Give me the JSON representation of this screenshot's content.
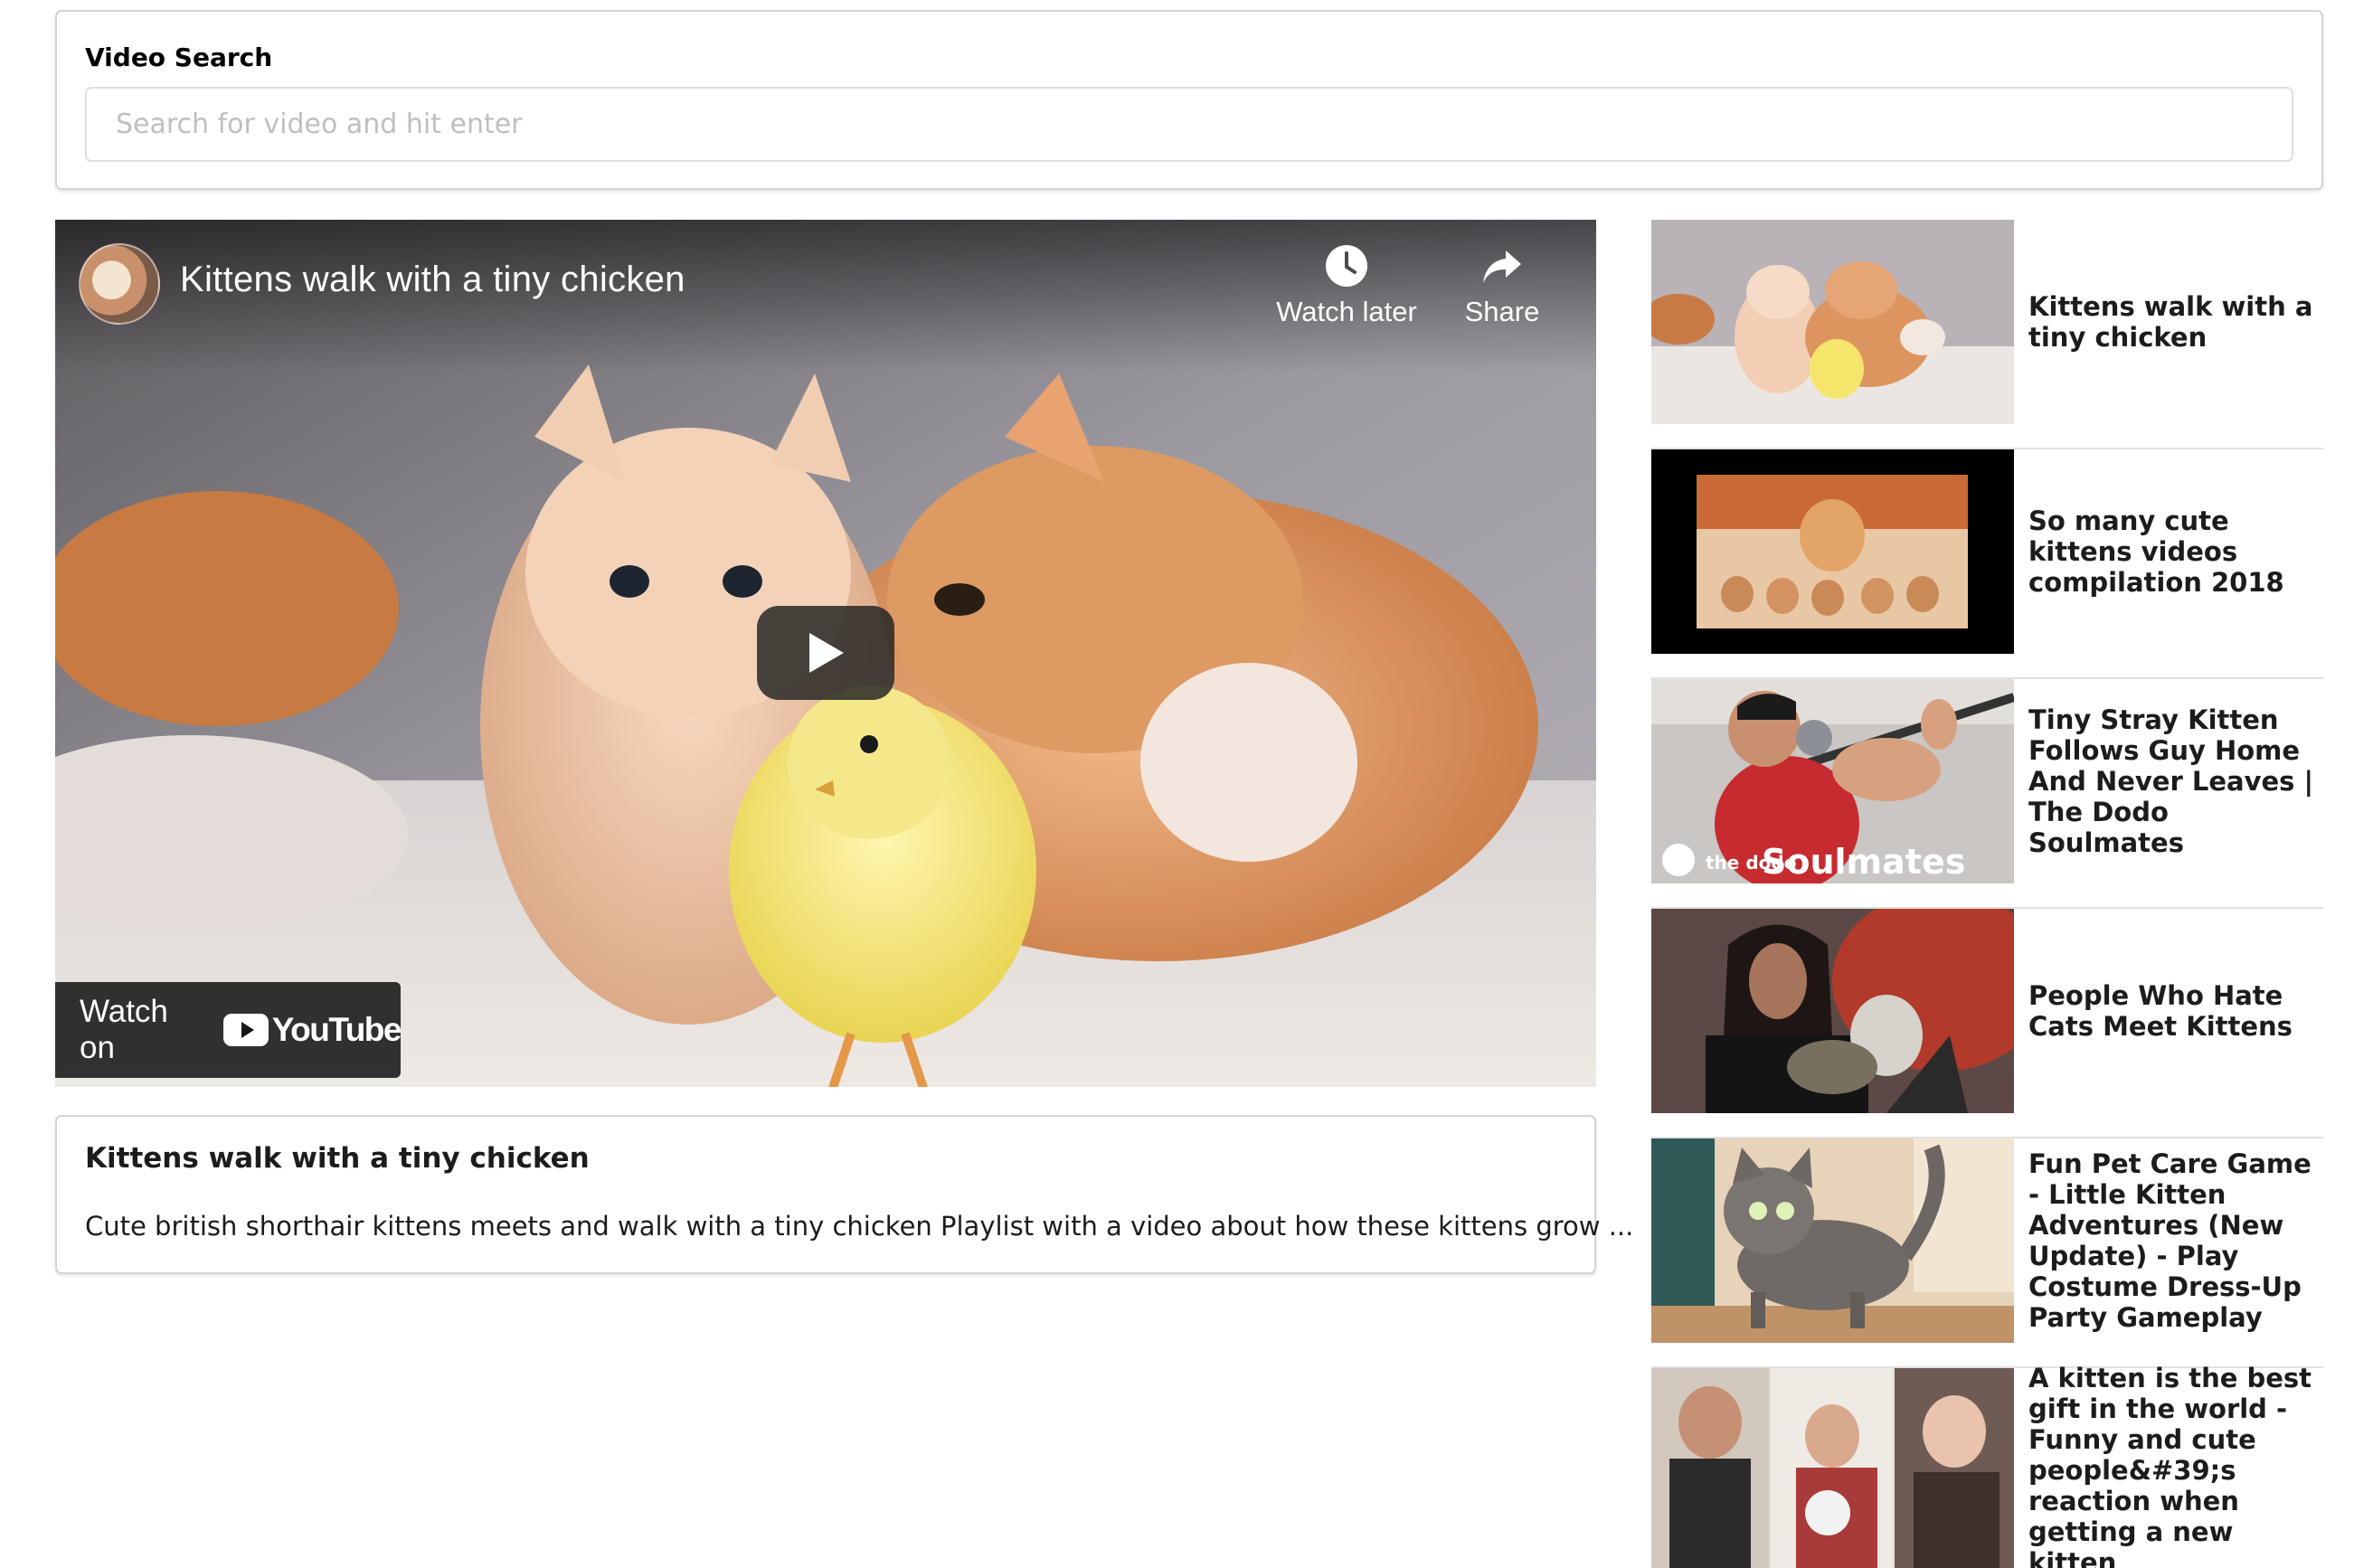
{
  "search": {
    "label": "Video Search",
    "placeholder": "Search for video and hit enter",
    "value": ""
  },
  "player": {
    "title": "Kittens walk with a tiny chicken",
    "watch_later_label": "Watch later",
    "share_label": "Share",
    "watch_on_label": "Watch on",
    "youtube_label": "YouTube",
    "icons": {
      "avatar": "channel-avatar",
      "watch_later": "clock-icon",
      "share": "share-arrow-icon",
      "play": "play-icon",
      "youtube": "youtube-logo-icon"
    }
  },
  "selected_video": {
    "title": "Kittens walk with a tiny chicken",
    "description": "Cute british shorthair kittens meets and walk with a tiny chicken Playlist with a video about how these kittens grow ..."
  },
  "video_list": [
    {
      "title": "Kittens walk with a tiny chicken"
    },
    {
      "title": "So many cute kittens videos compilation 2018"
    },
    {
      "title": "Tiny Stray Kitten Follows Guy Home And Never Leaves | The Dodo Soulmates"
    },
    {
      "title": "People Who Hate Cats Meet Kittens"
    },
    {
      "title": "Fun Pet Care Game - Little Kitten Adventures (New Update) - Play Costume Dress-Up Party Gameplay"
    },
    {
      "title": "A kitten is the best gift in the world - Funny and cute people&#39;s reaction when getting a new kitten"
    }
  ],
  "thumbnail_text": {
    "dodo_brand": "the dodo",
    "soulmates": "Soulmates"
  },
  "colors": {
    "border": "#d4d4d5",
    "text": "#1b1c1d",
    "placeholder": "#bfbfbf",
    "youtube_red": "#ff0000"
  }
}
